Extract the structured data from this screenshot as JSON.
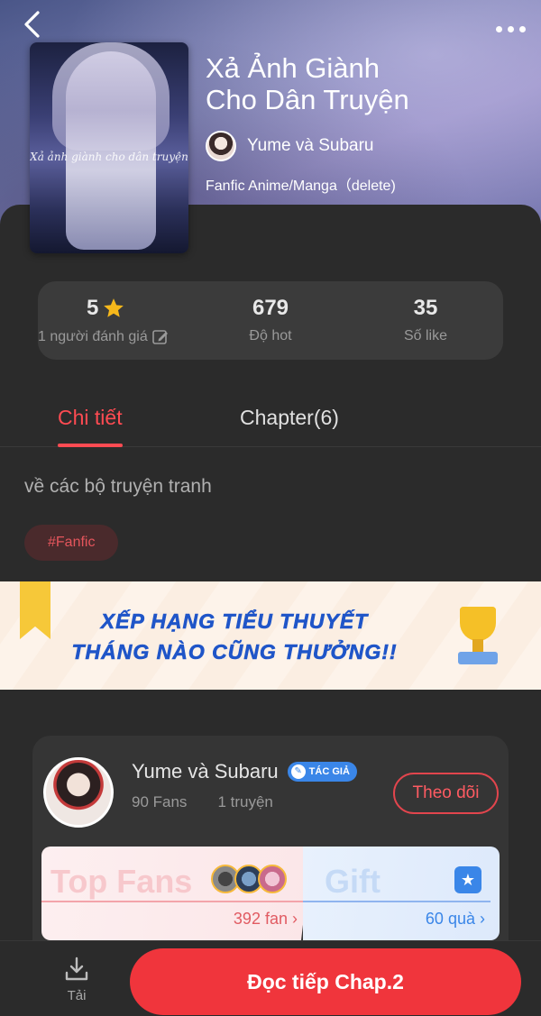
{
  "header": {
    "back_icon": "chevron-left-icon",
    "more_icon": "more-horizontal-icon",
    "book_title_line1": "Xả Ảnh Giành",
    "book_title_line2": "Cho Dân Truyện",
    "cover_text": "Xả ảnh giành cho dân truyện",
    "author": "Yume và Subaru",
    "genre": "Fanfic Anime/Manga（delete)"
  },
  "stats": {
    "rating_value": "5",
    "rating_label": "1 người đánh giá",
    "hot_value": "679",
    "hot_label": "Độ hot",
    "likes_value": "35",
    "likes_label": "Số like"
  },
  "tabs": {
    "detail": "Chi tiết",
    "chapter": "Chapter(6)"
  },
  "detail": {
    "description": "về các bộ truyện tranh",
    "tag": "#Fanfic"
  },
  "banner": {
    "line1": "XẾP HẠNG TIỂU THUYẾT",
    "line2": "THÁNG NÀO CŨNG THƯỞNG!!"
  },
  "author_card": {
    "name": "Yume và Subaru",
    "badge": "TÁC GIẢ",
    "fans": "90 Fans",
    "works": "1 truyện",
    "follow_label": "Theo dõi",
    "top_fans_title": "Top Fans",
    "top_fans_count": "392 fan",
    "gift_title": "Gift",
    "gift_count": "60 quà"
  },
  "bottom": {
    "download_label": "Tải",
    "read_label": "Đọc tiếp Chap.2"
  },
  "colors": {
    "accent": "#f0353c",
    "tab_active": "#ff4b52",
    "badge_blue": "#3a86e8"
  }
}
